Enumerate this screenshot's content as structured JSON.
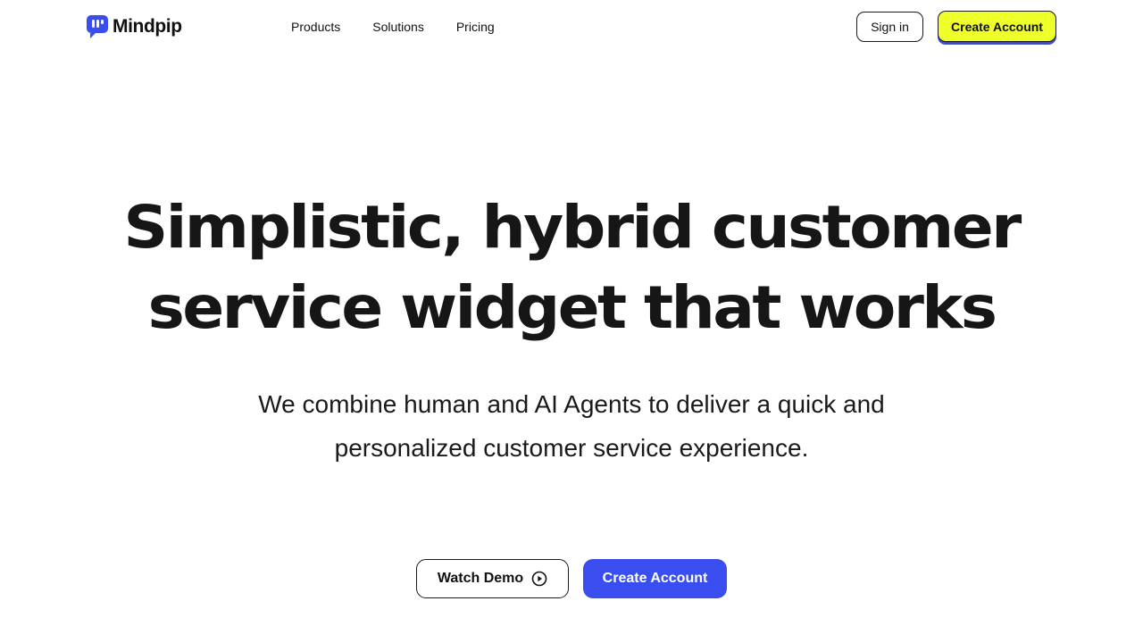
{
  "brand": {
    "name": "Mindpip",
    "icon": "chat-bubble-logo-icon",
    "color": "#3a4ef0"
  },
  "nav": {
    "links": [
      {
        "label": "Products"
      },
      {
        "label": "Solutions"
      },
      {
        "label": "Pricing"
      }
    ],
    "signin_label": "Sign in",
    "create_label": "Create Account",
    "create_color": "#eeff2a"
  },
  "hero": {
    "title_line1": "Simplistic, hybrid customer",
    "title_line2": "service widget that works",
    "subtitle_line1": "We combine human and AI Agents to deliver a quick and",
    "subtitle_line2": "personalized customer service experience."
  },
  "cta": {
    "demo_label": "Watch Demo",
    "demo_icon": "play-circle-icon",
    "create_label": "Create Account",
    "create_color": "#3a4ef0"
  }
}
